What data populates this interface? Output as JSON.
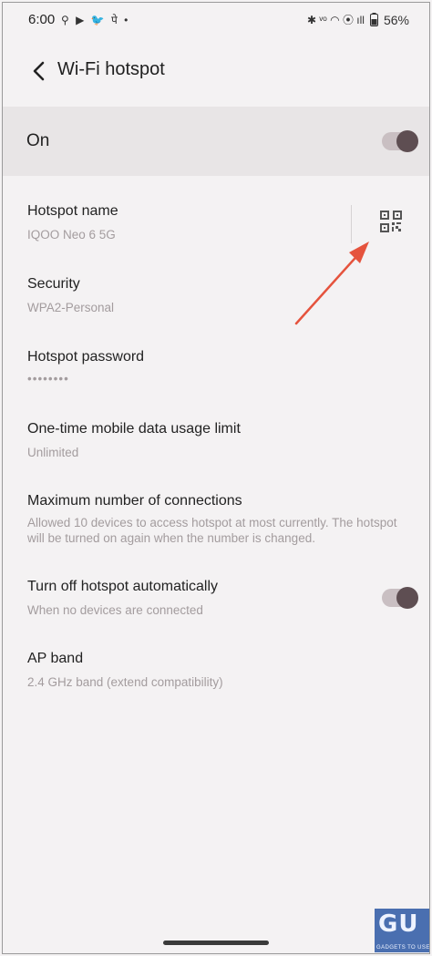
{
  "status_bar": {
    "time": "6:00",
    "left_icons": [
      "location-icon",
      "youtube-icon",
      "twitter-icon",
      "app-icon",
      "dot"
    ],
    "left_icons_text": "⚲ ▶ 🐦 पे •",
    "right_icons": [
      "bluetooth-icon",
      "volte-icon",
      "wifi-icon",
      "hotspot-icon",
      "signal-icon",
      "battery-icon"
    ],
    "right_icons_text": "✱ ᵛᵒ ◠ ⦿ ıll",
    "battery": "56%"
  },
  "header": {
    "title": "Wi-Fi hotspot"
  },
  "master_toggle": {
    "label": "On",
    "state": "on"
  },
  "settings": {
    "hotspot_name": {
      "title": "Hotspot name",
      "value": "IQOO Neo 6 5G"
    },
    "security": {
      "title": "Security",
      "value": "WPA2-Personal"
    },
    "password": {
      "title": "Hotspot password",
      "value": "••••••••"
    },
    "data_limit": {
      "title": "One-time mobile data usage limit",
      "value": "Unlimited"
    },
    "max_connections": {
      "title": "Maximum number of connections",
      "value": "Allowed 10 devices to access hotspot at most currently. The hotspot will be turned on again when the number is changed."
    },
    "auto_off": {
      "title": "Turn off hotspot automatically",
      "value": "When no devices are connected",
      "state": "on"
    },
    "ap_band": {
      "title": "AP band",
      "value": "2.4 GHz band (extend compatibility)"
    }
  },
  "colors": {
    "background": "#f4f2f3",
    "band": "#e8e5e6",
    "toggle_track": "#c9bfc2",
    "toggle_knob": "#5e4e52",
    "annotation_arrow": "#e5533d"
  },
  "watermark": {
    "logo": "GU",
    "text": "GADGETS TO USE"
  }
}
